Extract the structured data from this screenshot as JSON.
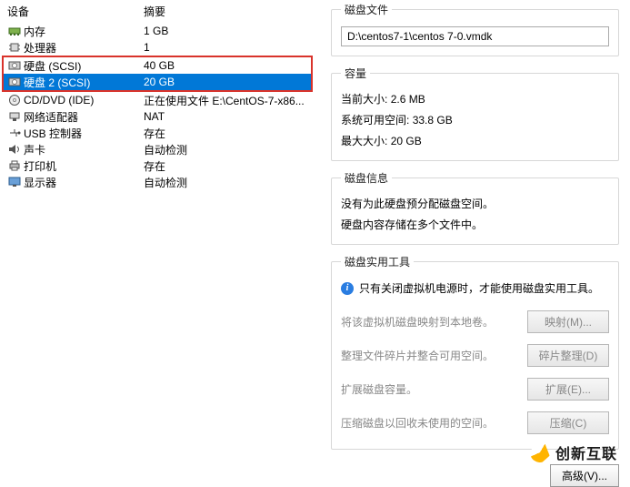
{
  "headers": {
    "device": "设备",
    "summary": "摘要"
  },
  "devices": {
    "memory": {
      "label": "内存",
      "value": "1 GB"
    },
    "cpu": {
      "label": "处理器",
      "value": "1"
    },
    "disk1": {
      "label": "硬盘 (SCSI)",
      "value": "40 GB"
    },
    "disk2": {
      "label": "硬盘 2 (SCSI)",
      "value": "20 GB"
    },
    "cd": {
      "label": "CD/DVD (IDE)",
      "value": "正在使用文件 E:\\CentOS-7-x86..."
    },
    "net": {
      "label": "网络适配器",
      "value": "NAT"
    },
    "usb": {
      "label": "USB 控制器",
      "value": "存在"
    },
    "sound": {
      "label": "声卡",
      "value": "自动检测"
    },
    "printer": {
      "label": "打印机",
      "value": "存在"
    },
    "display": {
      "label": "显示器",
      "value": "自动检测"
    }
  },
  "disk_file": {
    "legend": "磁盘文件",
    "path": "D:\\centos7-1\\centos 7-0.vmdk"
  },
  "capacity": {
    "legend": "容量",
    "current_label": "当前大小:",
    "current_value": "2.6 MB",
    "free_label": "系统可用空间:",
    "free_value": "33.8 GB",
    "max_label": "最大大小:",
    "max_value": "20 GB"
  },
  "disk_info": {
    "legend": "磁盘信息",
    "line1": "没有为此硬盘预分配磁盘空间。",
    "line2": "硬盘内容存储在多个文件中。"
  },
  "utilities": {
    "legend": "磁盘实用工具",
    "hint": "只有关闭虚拟机电源时，才能使用磁盘实用工具。",
    "map": {
      "desc": "将该虚拟机磁盘映射到本地卷。",
      "btn": "映射(M)..."
    },
    "defrag": {
      "desc": "整理文件碎片并整合可用空间。",
      "btn": "碎片整理(D)"
    },
    "expand": {
      "desc": "扩展磁盘容量。",
      "btn": "扩展(E)..."
    },
    "compact": {
      "desc": "压缩磁盘以回收未使用的空间。",
      "btn": "压缩(C)"
    }
  },
  "advanced_btn": "高级(V)...",
  "brand": "创新互联"
}
